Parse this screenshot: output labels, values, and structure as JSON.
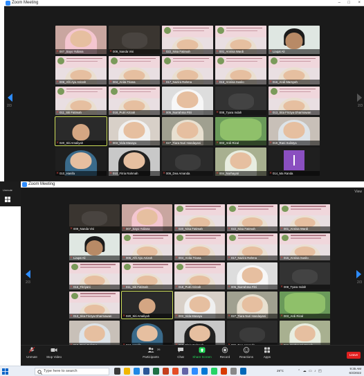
{
  "window1": {
    "title": "Zoom Meeting",
    "controls": [
      "–",
      "□",
      "×"
    ],
    "page_left": "2/3",
    "page_right": "2/3",
    "tiles": [
      {
        "name": "007_Sayo Yuliana",
        "kind": "hijab",
        "hood": "#f4c6d0",
        "bg": "#c9a6a0"
      },
      {
        "name": "009_Nanda Visi",
        "kind": "room",
        "bg": "#3a3530"
      },
      {
        "name": "022_Nisa Fatimah",
        "kind": "banner"
      },
      {
        "name": "001_Annisa Wardi",
        "kind": "banner"
      },
      {
        "name": "Liaqat Ali",
        "kind": "man",
        "bg": "#dfe7e2"
      },
      {
        "name": "006_Afri Ayu Azizah",
        "kind": "banner"
      },
      {
        "name": "004_Anita Triana",
        "kind": "banner"
      },
      {
        "name": "017_Nazira Rahma",
        "kind": "banner"
      },
      {
        "name": "015_Annisa Susilo",
        "kind": "banner"
      },
      {
        "name": "016_Andi Marsyah",
        "kind": "banner"
      },
      {
        "name": "011_Siti Fatimah",
        "kind": "banner"
      },
      {
        "name": "018_Putri Azizah",
        "kind": "banner"
      },
      {
        "name": "005_Nurrahma Fitri",
        "kind": "hijab",
        "hood": "#f7f7f7",
        "bg": "#ddd"
      },
      {
        "name": "008_Tyara Indah",
        "kind": "room",
        "bg": "#333"
      },
      {
        "name": "013_Sita Frictya Dharmawan",
        "kind": "banner"
      },
      {
        "name": "020_Siti Amaliyah",
        "kind": "face",
        "bg": "#2a2a2a",
        "active": true
      },
      {
        "name": "003_Vida Masayu",
        "kind": "hijab",
        "hood": "#f0f0f0",
        "bg": "#d8d0c8"
      },
      {
        "name": "027_Tiara Nuri Handayani",
        "kind": "hijab",
        "hood": "#e8e0d0",
        "bg": "#a0a090"
      },
      {
        "name": "003_Ardi Rizal",
        "kind": "green",
        "bg": "#6a9a5a"
      },
      {
        "name": "019_Rani Sulistya",
        "kind": "hijab",
        "hood": "#dde3e8",
        "bg": "#c8c0b8"
      },
      {
        "name": "010_Hanifa",
        "kind": "hijab",
        "hood": "#3a6a8a",
        "bg": "#1f1f1f"
      },
      {
        "name": "010_Fitria Rahmah",
        "kind": "hijab",
        "hood": "#222",
        "bg": "#c8c8c8"
      },
      {
        "name": "006_Dea Amanda",
        "kind": "room",
        "bg": "#2b2b2b"
      },
      {
        "name": "004_Nurhayati",
        "kind": "hijab",
        "hood": "#e8ede0",
        "bg": "#a8b090"
      },
      {
        "name": "014_Ma Randa",
        "kind": "purple"
      }
    ]
  },
  "window2": {
    "title": "Zoom Meeting",
    "view_label": "View",
    "page_left": "2/3",
    "page_right": "2/3",
    "tiles": [
      {
        "name": "009_Nanda Visi",
        "kind": "room",
        "bg": "#3a3530"
      },
      {
        "name": "007_Sayo Yuliana",
        "kind": "hijab",
        "hood": "#f4c6d0",
        "bg": "#c9a6a0"
      },
      {
        "name": "020_Nisa Fatimah",
        "kind": "banner"
      },
      {
        "name": "022_Nisa Fatimah",
        "kind": "banner"
      },
      {
        "name": "001_Annisa Wardi",
        "kind": "banner"
      },
      {
        "name": "Liaqat Ali",
        "kind": "man",
        "bg": "#dfe7e2"
      },
      {
        "name": "006_Afri Ayu Azizah",
        "kind": "banner"
      },
      {
        "name": "004_Anita Triana",
        "kind": "banner"
      },
      {
        "name": "017_Nazira Rahma",
        "kind": "banner"
      },
      {
        "name": "015_Annisa Susilo",
        "kind": "banner"
      },
      {
        "name": "016_Fitriyani",
        "kind": "banner"
      },
      {
        "name": "011_Siti Fatimah",
        "kind": "banner"
      },
      {
        "name": "018_Putri Azizah",
        "kind": "banner"
      },
      {
        "name": "005_Nurrahma Fitri",
        "kind": "hijab",
        "hood": "#f7f7f7",
        "bg": "#ddd"
      },
      {
        "name": "008_Tyara Indah",
        "kind": "room",
        "bg": "#333"
      },
      {
        "name": "013_Sita Frictya Dharmawan",
        "kind": "banner"
      },
      {
        "name": "020_Siti Amaliyah",
        "kind": "face",
        "bg": "#2a2a2a",
        "active": true
      },
      {
        "name": "003_Vida Masayu",
        "kind": "hijab",
        "hood": "#f0f0f0",
        "bg": "#d8d0c8"
      },
      {
        "name": "027_Tiara Nuri Handayani",
        "kind": "hijab",
        "hood": "#e8e0d0",
        "bg": "#a0a090"
      },
      {
        "name": "003_Ardi Rizal",
        "kind": "green",
        "bg": "#6a9a5a"
      },
      {
        "name": "019_Rani Sulistya",
        "kind": "hijab",
        "hood": "#dde3e8",
        "bg": "#c8c0b8"
      },
      {
        "name": "010_Hanifa",
        "kind": "hijab",
        "hood": "#3a6a8a",
        "bg": "#1f1f1f"
      },
      {
        "name": "010_Fitria Rahmah",
        "kind": "hijab",
        "hood": "#222",
        "bg": "#c8c8c8"
      },
      {
        "name": "006_Dea Amanda",
        "kind": "room",
        "bg": "#2b2b2b"
      },
      {
        "name": "016_Nurhayati Warsik",
        "kind": "hijab",
        "hood": "#e8ede0",
        "bg": "#a8b090"
      }
    ],
    "toolbar": {
      "unmute": "Unmute",
      "stop_video": "Stop Video",
      "participants": "Participants",
      "participants_count": "26",
      "chat": "Chat",
      "share_screen": "Share Screen",
      "record": "Record",
      "reactions": "Reactions",
      "apps": "Apps",
      "end": "Leave"
    },
    "accent": "#2d8cff",
    "share_color": "#23d959",
    "end_color": "#e02020"
  },
  "background_strip": {
    "label": "Unmute"
  },
  "taskbar": {
    "search_placeholder": "Type here to search",
    "weather": "29°C",
    "time": "9:35 AM",
    "date": "6/4/2022"
  }
}
